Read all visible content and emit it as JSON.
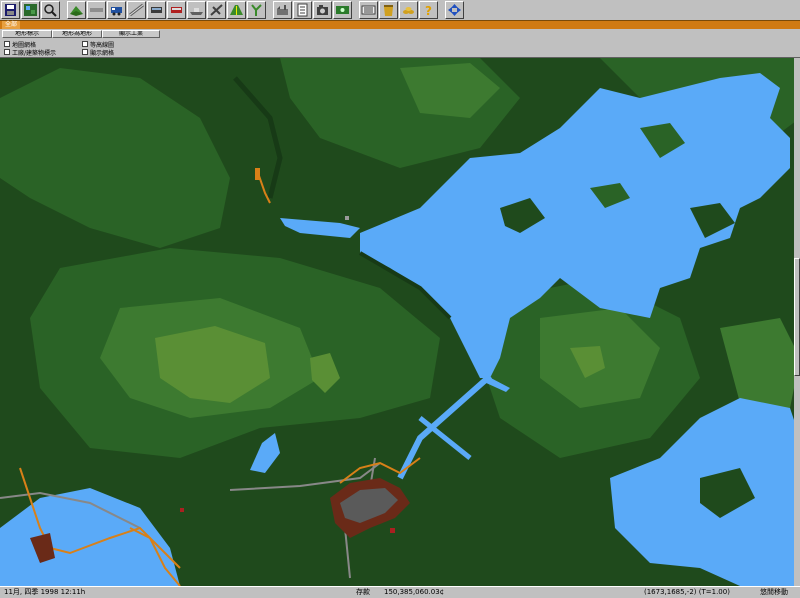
{
  "toolbar": {
    "buttons": [
      {
        "icon": "save-icon",
        "group": 1
      },
      {
        "icon": "map-icon",
        "group": 1
      },
      {
        "icon": "magnifier-icon",
        "group": 1
      },
      {
        "icon": "terrain-icon",
        "group": 2
      },
      {
        "icon": "rail-icon",
        "group": 2
      },
      {
        "icon": "train-icon",
        "group": 2
      },
      {
        "icon": "rail-track-icon",
        "group": 2
      },
      {
        "icon": "tram-icon",
        "group": 2
      },
      {
        "icon": "bus-icon",
        "group": 2
      },
      {
        "icon": "ship-icon",
        "group": 2
      },
      {
        "icon": "aircraft-icon",
        "group": 2
      },
      {
        "icon": "road-icon",
        "group": 2
      },
      {
        "icon": "fork-icon",
        "group": 2
      },
      {
        "icon": "factory-icon",
        "group": 3
      },
      {
        "icon": "document-icon",
        "group": 3
      },
      {
        "icon": "camera-icon",
        "group": 3
      },
      {
        "icon": "finance-icon",
        "group": 3
      },
      {
        "icon": "list-icon",
        "group": 4
      },
      {
        "icon": "bucket-icon",
        "group": 4
      },
      {
        "icon": "coins-icon",
        "group": 4
      },
      {
        "icon": "help-icon",
        "group": 4
      },
      {
        "icon": "scroll-arrows-icon",
        "group": 5
      }
    ]
  },
  "tab": {
    "label": "全部"
  },
  "panel": {
    "headers": [
      "地形標示",
      "地形為地形",
      "顯示工業"
    ],
    "options": [
      "地圖網格",
      "工廠/建築物標示",
      "等高線圖",
      "顯示網格"
    ]
  },
  "status": {
    "date": "11月, 四季 1998 12:11h",
    "money_label": "存款",
    "money": "150,385,060.03¢",
    "coords": "(1673,1685,-2) (T=1.00)",
    "extra": "悠閒移動"
  },
  "colors": {
    "water": "#5aaaf8",
    "forest_dark": "#1f4a1c",
    "forest_mid": "#2a6326",
    "forest_light": "#3d7a30",
    "highland": "#5a8f35",
    "road": "#888888",
    "rail": "#d88018",
    "town": "#6a2a18"
  }
}
